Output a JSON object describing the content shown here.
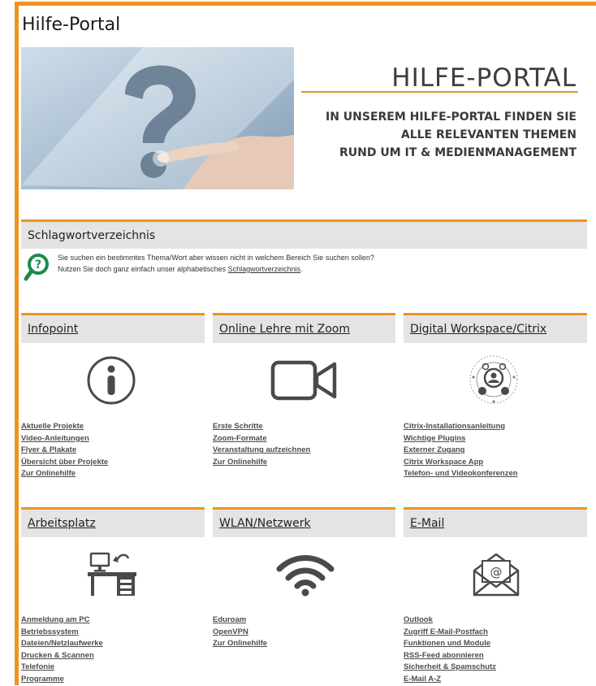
{
  "page": {
    "title": "Hilfe-Portal"
  },
  "banner": {
    "heading": "HILFE-PORTAL",
    "lines": [
      "IN UNSEREM HILFE-PORTAL FINDEN SIE",
      "ALLE RELEVANTEN THEMEN",
      "RUND UM IT & MEDIENMANAGEMENT"
    ]
  },
  "schlagwort": {
    "title": "Schlagwortverzeichnis",
    "line1": "Sie suchen ein bestimmtes Thema/Wort aber wissen nicht in welchem Bereich Sie suchen sollen?",
    "line2_prefix": "Nutzen Sie doch ganz einfach unser alphabetisches ",
    "line2_link": "Schlagwortverzeichnis",
    "line2_suffix": "."
  },
  "sections": [
    {
      "title": "Infopoint",
      "icon": "info-icon",
      "links": [
        "Aktuelle Projekte",
        "Video-Anleitungen",
        "Flyer & Plakate",
        "Übersicht über Projekte",
        "Zur Onlinehilfe"
      ]
    },
    {
      "title": "Online Lehre mit Zoom",
      "icon": "video-camera-icon",
      "links": [
        "Erste Schritte",
        "Zoom-Formate",
        "Veranstaltung aufzeichnen",
        "Zur Onlinehilfe"
      ]
    },
    {
      "title": "Digital Workspace/Citrix",
      "icon": "network-user-icon",
      "links": [
        "Citrix-Installationsanleitung",
        "Wichtige Plugins",
        "Externer Zugang",
        "Citrix Workspace App",
        "Telefon- und Videokonferenzen"
      ]
    },
    {
      "title": "Arbeitsplatz",
      "icon": "desk-computer-icon",
      "links": [
        "Anmeldung am PC",
        "Betriebssystem",
        "Dateien/Netzlaufwerke",
        "Drucken & Scannen",
        "Telefonie",
        "Programme"
      ]
    },
    {
      "title": "WLAN/Netzwerk",
      "icon": "wifi-icon",
      "links": [
        "Eduroam",
        "OpenVPN",
        "Zur Onlinehilfe"
      ]
    },
    {
      "title": "E-Mail",
      "icon": "email-envelope-icon",
      "links": [
        "Outlook",
        "Zugriff E-Mail-Postfach",
        "Funktionen und Module",
        "RSS-Feed abonnieren",
        "Sicherheit & Spamschutz",
        "E-Mail A-Z"
      ]
    }
  ],
  "colors": {
    "accent": "#f0931e",
    "bar": "#e4e4e4",
    "icon": "#4a4a4a",
    "hint_icon": "#1d8a4a"
  }
}
